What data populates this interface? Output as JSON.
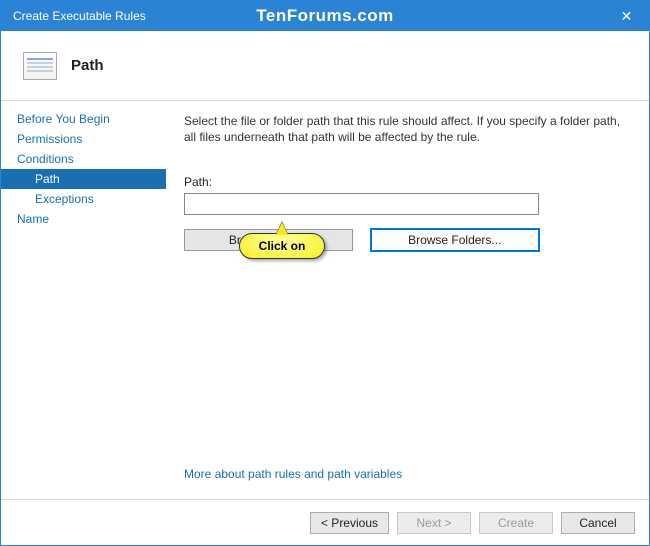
{
  "titlebar": {
    "title": "Create Executable Rules",
    "watermark": "TenForums.com",
    "close_glyph": "✕"
  },
  "header": {
    "heading": "Path"
  },
  "sidebar": {
    "items": [
      {
        "label": "Before You Begin",
        "child": false,
        "current": false
      },
      {
        "label": "Permissions",
        "child": false,
        "current": false
      },
      {
        "label": "Conditions",
        "child": false,
        "current": false
      },
      {
        "label": "Path",
        "child": true,
        "current": true
      },
      {
        "label": "Exceptions",
        "child": true,
        "current": false
      },
      {
        "label": "Name",
        "child": false,
        "current": false
      }
    ]
  },
  "content": {
    "description": "Select the file or folder path that this rule should affect. If you specify a folder path, all files underneath that path will be affected by the rule.",
    "path_label": "Path:",
    "path_value": "",
    "browse_files_label": "Browse Files...",
    "browse_folders_label": "Browse Folders...",
    "callout_text": "Click on",
    "more_link": "More about path rules and path variables"
  },
  "footer": {
    "previous": "< Previous",
    "next": "Next >",
    "create": "Create",
    "cancel": "Cancel"
  }
}
